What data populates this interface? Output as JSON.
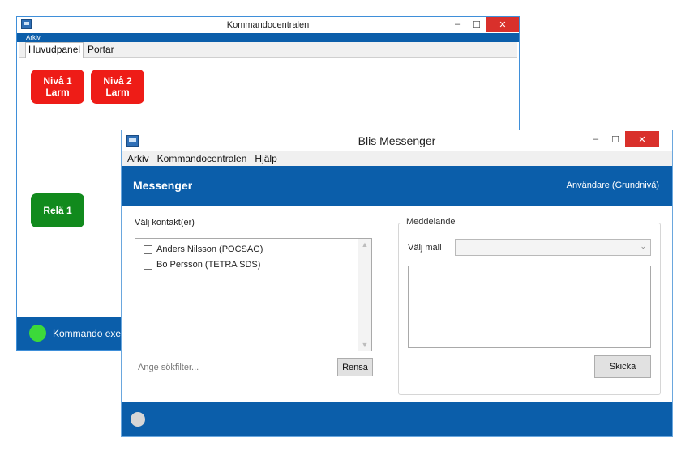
{
  "back_window": {
    "title": "Kommandocentralen",
    "menu": [
      "Arkiv"
    ],
    "tabs": [
      {
        "label": "Huvudpanel",
        "active": true
      },
      {
        "label": "Portar",
        "active": false
      }
    ],
    "alarm_buttons": [
      {
        "line1": "Nivå 1",
        "line2": "Larm",
        "color": "#ee1c17"
      },
      {
        "line1": "Nivå 2",
        "line2": "Larm",
        "color": "#ee1c17"
      }
    ],
    "relay_button": {
      "label": "Relä 1",
      "color": "#118a1d"
    },
    "status": {
      "text": "Kommando exek",
      "indicator_color": "#3cd93a"
    }
  },
  "front_window": {
    "title": "Blis Messenger",
    "menu": [
      "Arkiv",
      "Kommandocentralen",
      "Hjälp"
    ],
    "header": {
      "title": "Messenger",
      "user": "Användare (Grundnivå)"
    },
    "contacts": {
      "label": "Välj kontakt(er)",
      "items": [
        {
          "label": "Anders Nilsson (POCSAG)",
          "checked": false
        },
        {
          "label": "Bo Persson (TETRA SDS)",
          "checked": false
        }
      ],
      "filter_placeholder": "Ange sökfilter...",
      "clear_label": "Rensa"
    },
    "message": {
      "group_label": "Meddelande",
      "template_label": "Välj mall",
      "template_value": "",
      "body": "",
      "send_label": "Skicka"
    },
    "status": {
      "indicator_color": "#d6d6d6"
    }
  },
  "colors": {
    "accent": "#0b5eaa",
    "close_button": "#d9302b"
  },
  "icons": [
    "app-icon",
    "minimize-icon",
    "maximize-icon",
    "close-icon",
    "chevron-down-icon",
    "scroll-up-icon",
    "scroll-down-icon"
  ]
}
